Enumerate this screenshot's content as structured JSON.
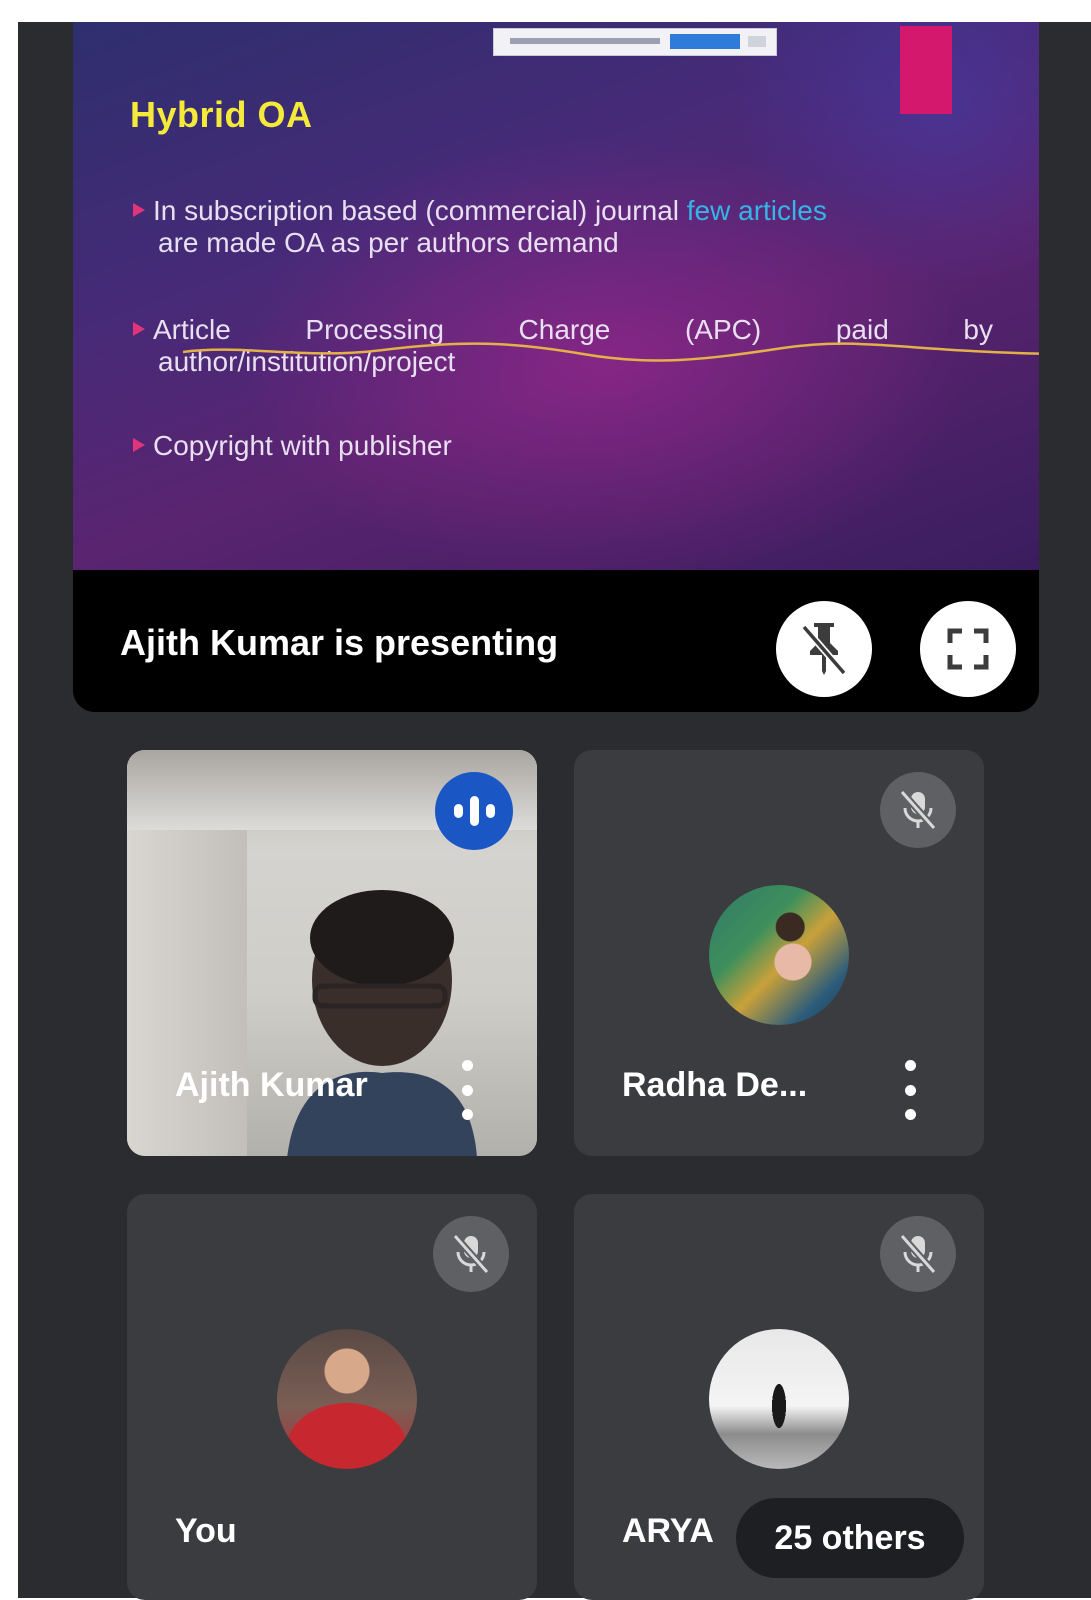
{
  "slide": {
    "title": "Hybrid OA",
    "bullet1_part1": "In subscription based (commercial) journal ",
    "bullet1_highlight": "few articles",
    "bullet1_line2": "are made OA as per authors demand",
    "bullet2_words": [
      "Article",
      "Processing",
      "Charge",
      "(APC)",
      "paid",
      "by"
    ],
    "bullet2_line2": "author/institution/project",
    "bullet3": "Copyright with publisher"
  },
  "presenter": {
    "text": "Ajith Kumar is presenting",
    "unpin_icon": "unpin-icon",
    "fullscreen_icon": "fullscreen-icon"
  },
  "participants": [
    {
      "name": "Ajith Kumar",
      "status": "speaking"
    },
    {
      "name": "Radha De...",
      "status": "muted"
    },
    {
      "name": "You",
      "status": "muted"
    },
    {
      "name": "ARYA",
      "status": "muted"
    }
  ],
  "others": {
    "label": "25 others"
  },
  "colors": {
    "app_background": "#2b2c2f",
    "tile_background": "#3b3c40",
    "slide_title": "#f5ea3a",
    "slide_highlight": "#36b4e8",
    "slide_accent": "#d3186e",
    "speaking_badge": "#1a57c5"
  }
}
